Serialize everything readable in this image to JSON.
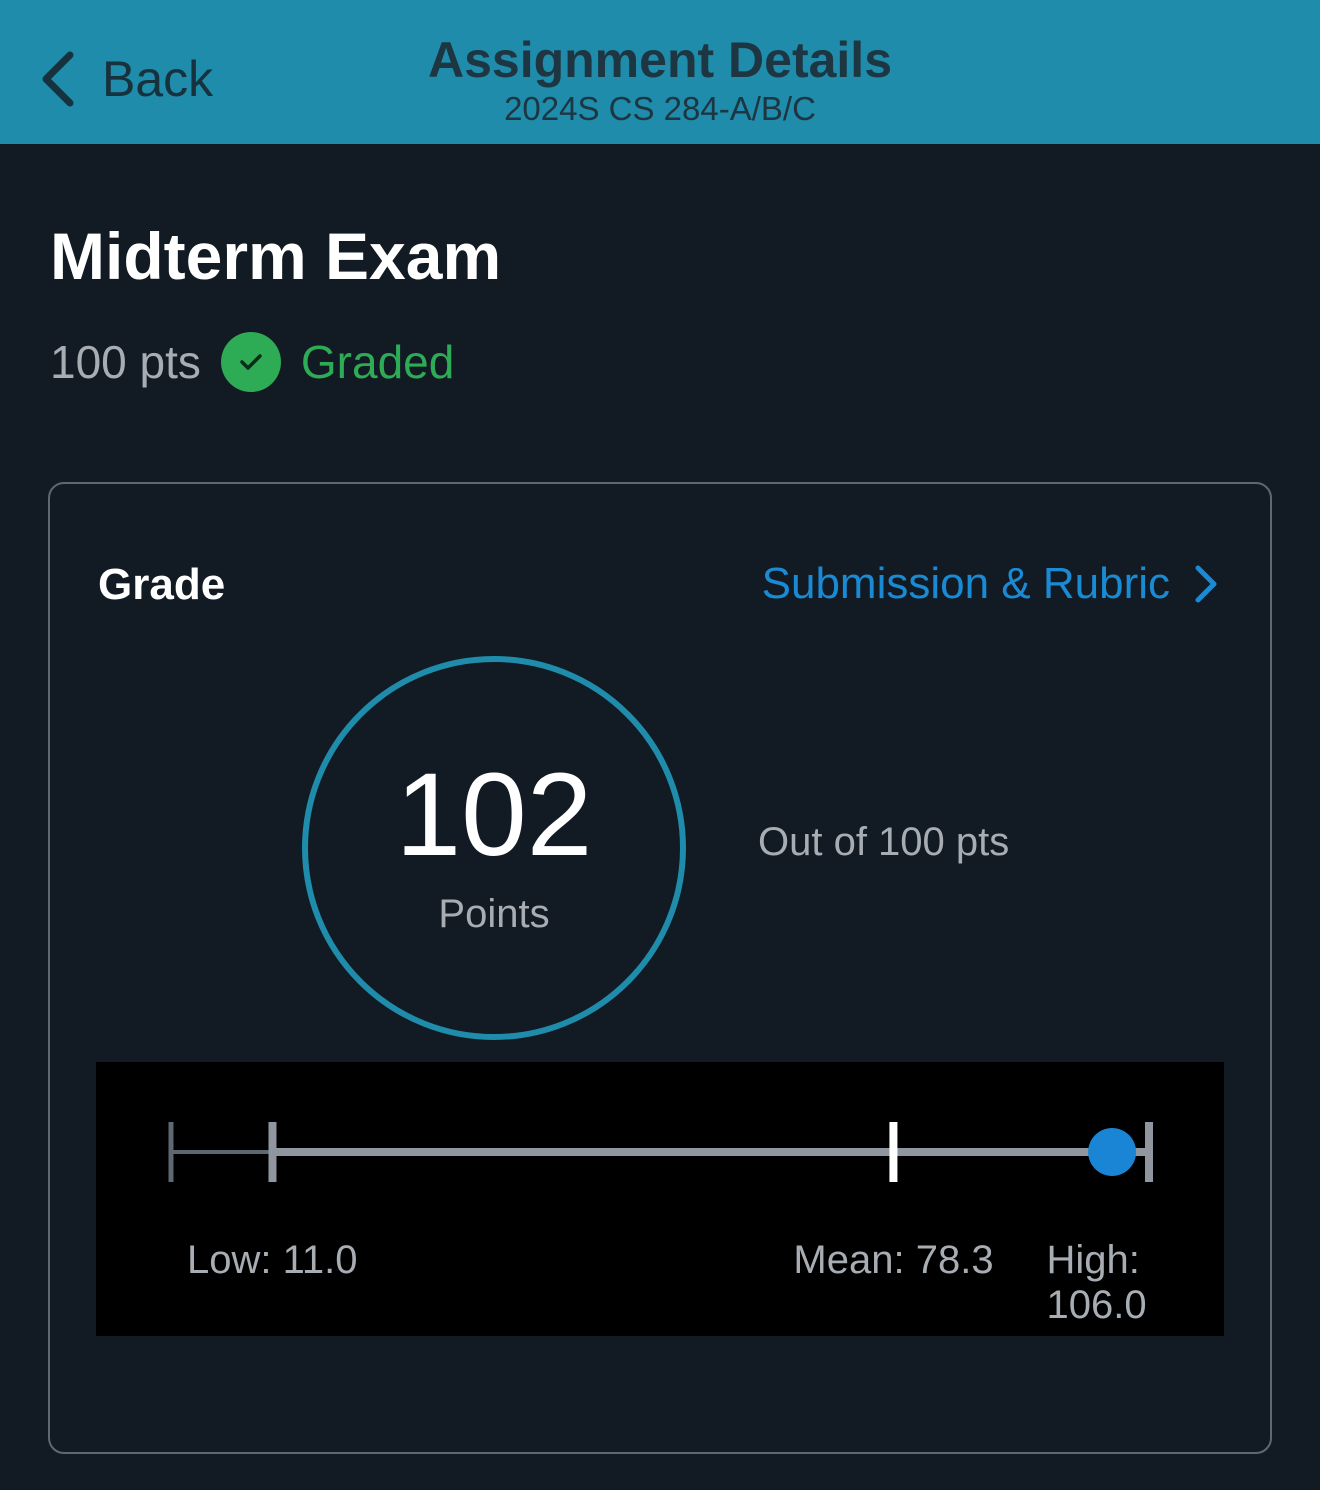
{
  "header": {
    "back_label": "Back",
    "title": "Assignment Details",
    "subtitle": "2024S CS 284-A/B/C"
  },
  "assignment": {
    "title": "Midterm Exam",
    "points": "100 pts",
    "status": "Graded"
  },
  "grade_card": {
    "label": "Grade",
    "link_label": "Submission & Rubric",
    "score": "102",
    "score_unit": "Points",
    "out_of": "Out of 100 pts"
  },
  "stats": {
    "low_label": "Low: 11.0",
    "mean_label": "Mean: 78.3",
    "high_label": "High: 106.0",
    "low": 11.0,
    "mean": 78.3,
    "high": 106.0,
    "score": 102,
    "axis_min": 0
  },
  "colors": {
    "header_bg": "#1e8caa",
    "page_bg": "#121b23",
    "success": "#2eab55",
    "link": "#1a8ad4",
    "marker": "#1a85d4"
  },
  "icons": {
    "back": "chevron-left-icon",
    "status": "check-circle-icon",
    "link": "chevron-right-icon"
  }
}
